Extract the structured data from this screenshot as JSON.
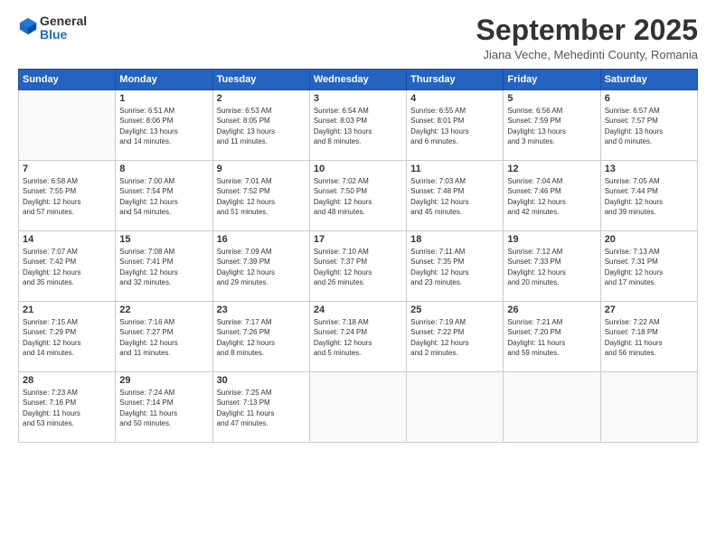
{
  "header": {
    "logo_general": "General",
    "logo_blue": "Blue",
    "month_title": "September 2025",
    "location": "Jiana Veche, Mehedinti County, Romania"
  },
  "days_of_week": [
    "Sunday",
    "Monday",
    "Tuesday",
    "Wednesday",
    "Thursday",
    "Friday",
    "Saturday"
  ],
  "weeks": [
    [
      {
        "day": "",
        "info": ""
      },
      {
        "day": "1",
        "info": "Sunrise: 6:51 AM\nSunset: 8:06 PM\nDaylight: 13 hours\nand 14 minutes."
      },
      {
        "day": "2",
        "info": "Sunrise: 6:53 AM\nSunset: 8:05 PM\nDaylight: 13 hours\nand 11 minutes."
      },
      {
        "day": "3",
        "info": "Sunrise: 6:54 AM\nSunset: 8:03 PM\nDaylight: 13 hours\nand 8 minutes."
      },
      {
        "day": "4",
        "info": "Sunrise: 6:55 AM\nSunset: 8:01 PM\nDaylight: 13 hours\nand 6 minutes."
      },
      {
        "day": "5",
        "info": "Sunrise: 6:56 AM\nSunset: 7:59 PM\nDaylight: 13 hours\nand 3 minutes."
      },
      {
        "day": "6",
        "info": "Sunrise: 6:57 AM\nSunset: 7:57 PM\nDaylight: 13 hours\nand 0 minutes."
      }
    ],
    [
      {
        "day": "7",
        "info": "Sunrise: 6:58 AM\nSunset: 7:55 PM\nDaylight: 12 hours\nand 57 minutes."
      },
      {
        "day": "8",
        "info": "Sunrise: 7:00 AM\nSunset: 7:54 PM\nDaylight: 12 hours\nand 54 minutes."
      },
      {
        "day": "9",
        "info": "Sunrise: 7:01 AM\nSunset: 7:52 PM\nDaylight: 12 hours\nand 51 minutes."
      },
      {
        "day": "10",
        "info": "Sunrise: 7:02 AM\nSunset: 7:50 PM\nDaylight: 12 hours\nand 48 minutes."
      },
      {
        "day": "11",
        "info": "Sunrise: 7:03 AM\nSunset: 7:48 PM\nDaylight: 12 hours\nand 45 minutes."
      },
      {
        "day": "12",
        "info": "Sunrise: 7:04 AM\nSunset: 7:46 PM\nDaylight: 12 hours\nand 42 minutes."
      },
      {
        "day": "13",
        "info": "Sunrise: 7:05 AM\nSunset: 7:44 PM\nDaylight: 12 hours\nand 39 minutes."
      }
    ],
    [
      {
        "day": "14",
        "info": "Sunrise: 7:07 AM\nSunset: 7:42 PM\nDaylight: 12 hours\nand 35 minutes."
      },
      {
        "day": "15",
        "info": "Sunrise: 7:08 AM\nSunset: 7:41 PM\nDaylight: 12 hours\nand 32 minutes."
      },
      {
        "day": "16",
        "info": "Sunrise: 7:09 AM\nSunset: 7:39 PM\nDaylight: 12 hours\nand 29 minutes."
      },
      {
        "day": "17",
        "info": "Sunrise: 7:10 AM\nSunset: 7:37 PM\nDaylight: 12 hours\nand 26 minutes."
      },
      {
        "day": "18",
        "info": "Sunrise: 7:11 AM\nSunset: 7:35 PM\nDaylight: 12 hours\nand 23 minutes."
      },
      {
        "day": "19",
        "info": "Sunrise: 7:12 AM\nSunset: 7:33 PM\nDaylight: 12 hours\nand 20 minutes."
      },
      {
        "day": "20",
        "info": "Sunrise: 7:13 AM\nSunset: 7:31 PM\nDaylight: 12 hours\nand 17 minutes."
      }
    ],
    [
      {
        "day": "21",
        "info": "Sunrise: 7:15 AM\nSunset: 7:29 PM\nDaylight: 12 hours\nand 14 minutes."
      },
      {
        "day": "22",
        "info": "Sunrise: 7:16 AM\nSunset: 7:27 PM\nDaylight: 12 hours\nand 11 minutes."
      },
      {
        "day": "23",
        "info": "Sunrise: 7:17 AM\nSunset: 7:26 PM\nDaylight: 12 hours\nand 8 minutes."
      },
      {
        "day": "24",
        "info": "Sunrise: 7:18 AM\nSunset: 7:24 PM\nDaylight: 12 hours\nand 5 minutes."
      },
      {
        "day": "25",
        "info": "Sunrise: 7:19 AM\nSunset: 7:22 PM\nDaylight: 12 hours\nand 2 minutes."
      },
      {
        "day": "26",
        "info": "Sunrise: 7:21 AM\nSunset: 7:20 PM\nDaylight: 11 hours\nand 59 minutes."
      },
      {
        "day": "27",
        "info": "Sunrise: 7:22 AM\nSunset: 7:18 PM\nDaylight: 11 hours\nand 56 minutes."
      }
    ],
    [
      {
        "day": "28",
        "info": "Sunrise: 7:23 AM\nSunset: 7:16 PM\nDaylight: 11 hours\nand 53 minutes."
      },
      {
        "day": "29",
        "info": "Sunrise: 7:24 AM\nSunset: 7:14 PM\nDaylight: 11 hours\nand 50 minutes."
      },
      {
        "day": "30",
        "info": "Sunrise: 7:25 AM\nSunset: 7:13 PM\nDaylight: 11 hours\nand 47 minutes."
      },
      {
        "day": "",
        "info": ""
      },
      {
        "day": "",
        "info": ""
      },
      {
        "day": "",
        "info": ""
      },
      {
        "day": "",
        "info": ""
      }
    ]
  ]
}
